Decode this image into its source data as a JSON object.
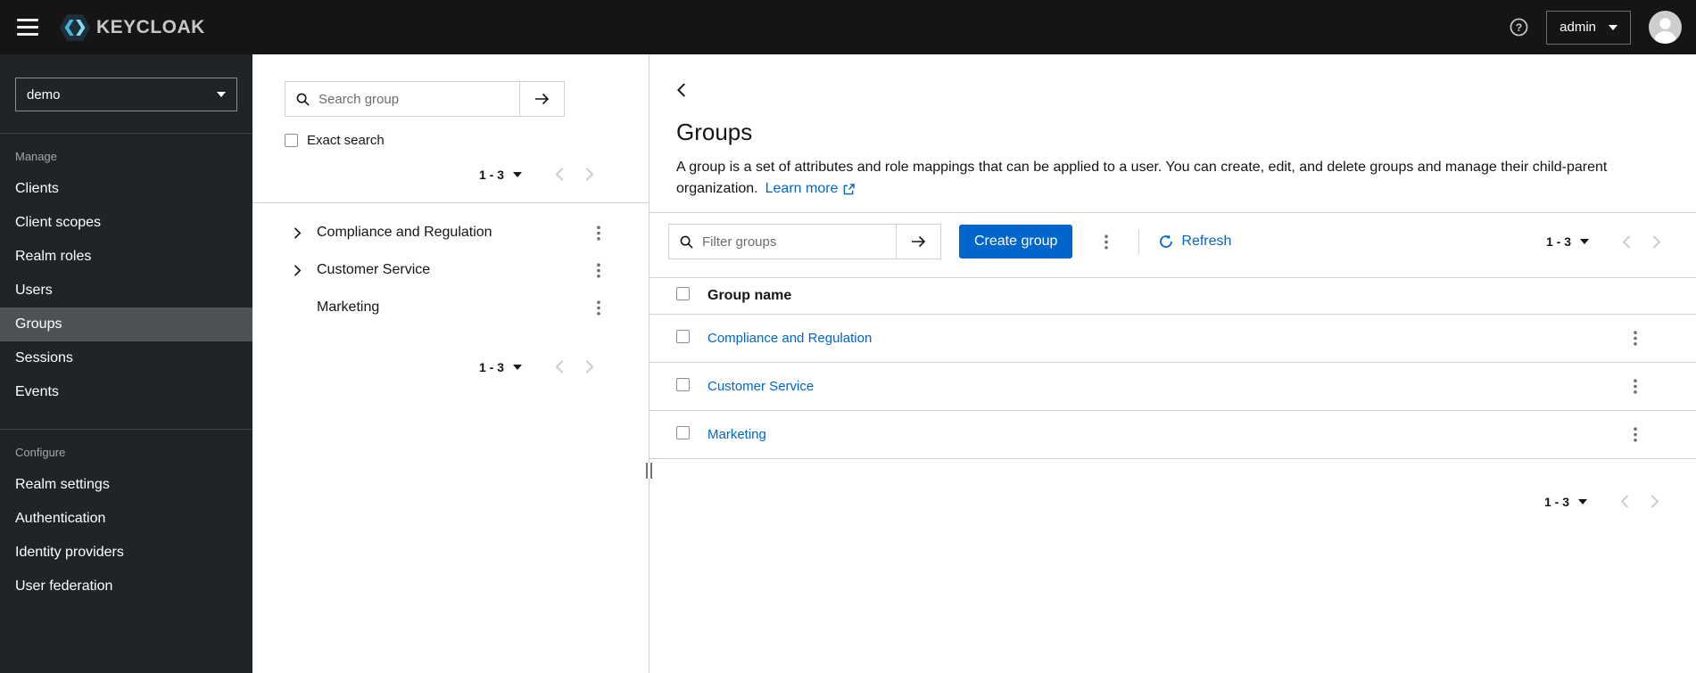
{
  "header": {
    "brand": "KEYCLOAK",
    "user_menu_label": "admin"
  },
  "sidebar": {
    "realm_selector_value": "demo",
    "active_item": "Groups",
    "sections": [
      {
        "label": "Manage",
        "items": [
          {
            "label": "Clients"
          },
          {
            "label": "Client scopes"
          },
          {
            "label": "Realm roles"
          },
          {
            "label": "Users"
          },
          {
            "label": "Groups"
          },
          {
            "label": "Sessions"
          },
          {
            "label": "Events"
          }
        ]
      },
      {
        "label": "Configure",
        "items": [
          {
            "label": "Realm settings"
          },
          {
            "label": "Authentication"
          },
          {
            "label": "Identity providers"
          },
          {
            "label": "User federation"
          }
        ]
      }
    ]
  },
  "tree": {
    "search_placeholder": "Search group",
    "exact_search_label": "Exact search",
    "pagination_top": {
      "range": "1 - 3"
    },
    "items": [
      {
        "label": "Compliance and Regulation",
        "expandable": true
      },
      {
        "label": "Customer Service",
        "expandable": true
      },
      {
        "label": "Marketing",
        "expandable": false
      }
    ],
    "pagination_bottom": {
      "range": "1 - 3"
    }
  },
  "main": {
    "title": "Groups",
    "description": "A group is a set of attributes and role mappings that can be applied to a user. You can create, edit, and delete groups and manage their child-parent organization.",
    "learn_more_label": "Learn more",
    "toolbar": {
      "filter_placeholder": "Filter groups",
      "create_button_label": "Create group",
      "refresh_label": "Refresh",
      "pagination": {
        "range": "1 - 3"
      }
    },
    "table": {
      "columns": [
        "Group name"
      ],
      "rows": [
        {
          "name": "Compliance and Regulation"
        },
        {
          "name": "Customer Service"
        },
        {
          "name": "Marketing"
        }
      ]
    },
    "pagination_bottom": {
      "range": "1 - 3"
    }
  },
  "icons": {
    "hamburger": "≡",
    "help": "?",
    "caret-down": "▾",
    "angle-left": "‹",
    "angle-right": "›",
    "kebab": "⋮",
    "search": "magnifier-shape",
    "arrow-right": "→",
    "refresh": "⟳",
    "external-link": "⧉",
    "avatar": "person-silhouette",
    "keycloak-logo": "hexagon-mark"
  },
  "colors": {
    "primary_blue": "#0066cc",
    "link_blue": "#0066cc",
    "masthead_bg": "#151515",
    "sidebar_bg": "#212427",
    "sidebar_active_bg": "#4f5255",
    "border": "#d2d2d2",
    "logo_cyan": "#43b9d6"
  }
}
